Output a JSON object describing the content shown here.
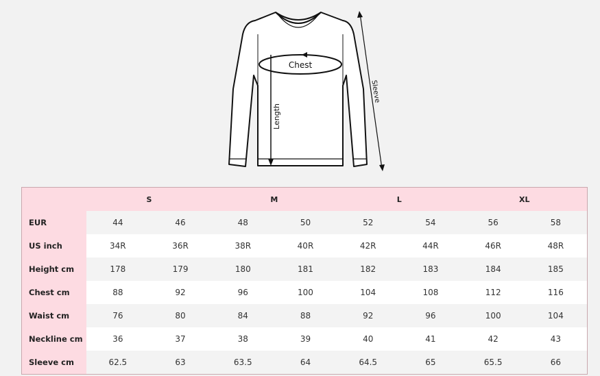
{
  "diagram": {
    "labels": {
      "chest": "Chest",
      "length": "Length",
      "sleeve": "Sleeve"
    }
  },
  "table": {
    "sizes": [
      "S",
      "M",
      "L",
      "XL"
    ],
    "rows": [
      {
        "label": "EUR",
        "values": [
          "44",
          "46",
          "48",
          "50",
          "52",
          "54",
          "56",
          "58"
        ]
      },
      {
        "label": "US inch",
        "values": [
          "34R",
          "36R",
          "38R",
          "40R",
          "42R",
          "44R",
          "46R",
          "48R"
        ]
      },
      {
        "label": "Height cm",
        "values": [
          "178",
          "179",
          "180",
          "181",
          "182",
          "183",
          "184",
          "185"
        ]
      },
      {
        "label": "Chest cm",
        "values": [
          "88",
          "92",
          "96",
          "100",
          "104",
          "108",
          "112",
          "116"
        ]
      },
      {
        "label": "Waist cm",
        "values": [
          "76",
          "80",
          "84",
          "88",
          "92",
          "96",
          "100",
          "104"
        ]
      },
      {
        "label": "Neckline cm",
        "values": [
          "36",
          "37",
          "38",
          "39",
          "40",
          "41",
          "42",
          "43"
        ]
      },
      {
        "label": "Sleeve cm",
        "values": [
          "62.5",
          "63",
          "63.5",
          "64",
          "64.5",
          "65",
          "65.5",
          "66"
        ]
      }
    ]
  }
}
